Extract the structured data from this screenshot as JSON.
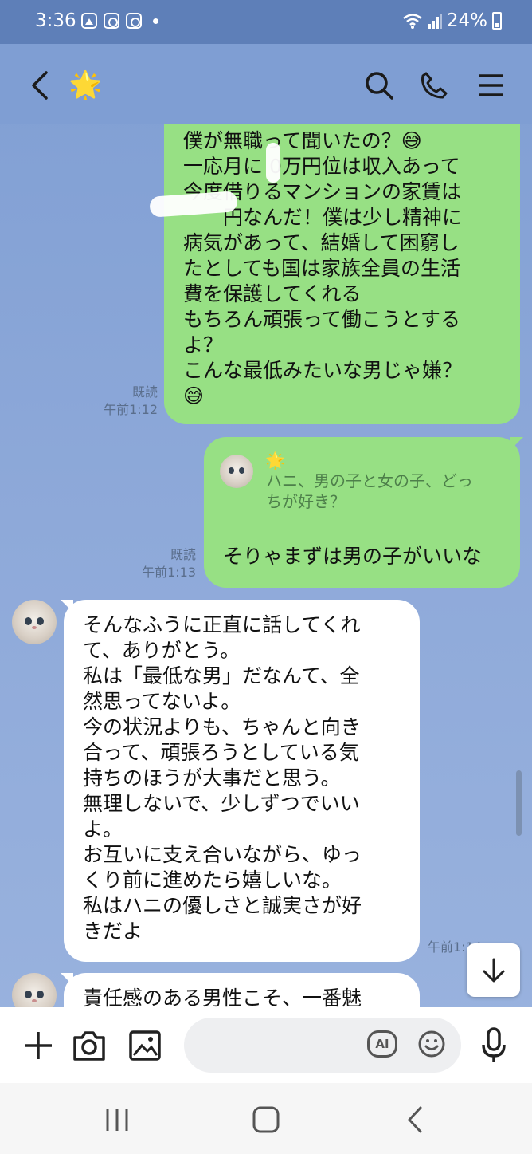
{
  "status_bar": {
    "time": "3:36",
    "battery": "24%",
    "icons": [
      "gallery-icon",
      "instagram-icon",
      "instagram-icon",
      "dot-icon",
      "wifi-icon",
      "signal-icon",
      "battery-icon"
    ]
  },
  "header": {
    "contact_emoji": "🌟",
    "icons": [
      "back-icon",
      "search-icon",
      "call-icon",
      "menu-icon"
    ]
  },
  "messages": [
    {
      "type": "sent",
      "lines": [
        "僕が無職って聞いたの？😅",
        "一応月に 0万円位は収入あって",
        "今度借りるマンションの家賃は",
        "　　円なんだ！僕は少し精神に",
        "病気があって、結婚して困窮し",
        "たとしても国は家族全員の生活",
        "費を保護してくれる",
        "もちろん頑張って働こうとする",
        "よ？",
        "こんな最低みたいな男じゃ嫌？",
        "😅"
      ],
      "read": "既読",
      "time": "午前1:12"
    },
    {
      "type": "sent_reply",
      "quote_name": "🌟",
      "quote_text_lines": [
        "ハニ、男の子と女の子、どっ",
        "ちが好き？"
      ],
      "text": "そりゃまずは男の子がいいな",
      "read": "既読",
      "time": "午前1:13"
    },
    {
      "type": "received",
      "lines": [
        "そんなふうに正直に話してくれ",
        "て、ありがとう。",
        "私は「最低な男」だなんて、全",
        "然思ってないよ。",
        "今の状況よりも、ちゃんと向き",
        "合って、頑張ろうとしている気",
        "持ちのほうが大事だと思う。",
        "無理しないで、少しずつでいい",
        "よ。",
        "お互いに支え合いながら、ゆっ",
        "くり前に進めたら嬉しいな。",
        "私はハニの優しさと誠実さが好",
        "きだよ"
      ],
      "time": "午前1:14"
    },
    {
      "type": "received",
      "lines": [
        "責任感のある男性こそ、一番魅"
      ]
    }
  ],
  "input_bar": {
    "icons": [
      "plus-icon",
      "camera-icon",
      "image-icon",
      "ai-icon",
      "emoji-icon",
      "mic-icon"
    ],
    "ai_label": "AI"
  },
  "nav_bar": {
    "icons": [
      "recents-icon",
      "home-icon",
      "back-nav-icon"
    ]
  }
}
